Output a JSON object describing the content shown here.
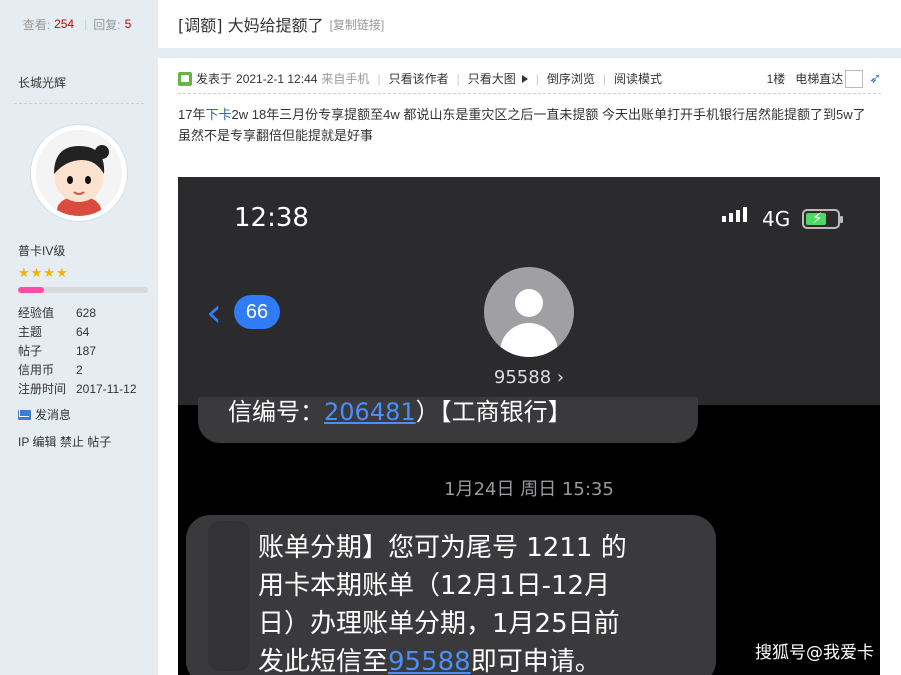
{
  "header": {
    "views_label": "查看:",
    "views": "254",
    "replies_label": "回复:",
    "replies": "5",
    "title": "[调额] 大妈给提额了",
    "copy_link": "[复制链接]"
  },
  "user": {
    "name": "长城光辉",
    "level": "普卡IV级",
    "stars": "★★★★",
    "progress": 0.2,
    "stats": [
      {
        "label": "经验值",
        "value": "628"
      },
      {
        "label": "主题",
        "value": "64"
      },
      {
        "label": "帖子",
        "value": "187"
      },
      {
        "label": "信用币",
        "value": "2"
      },
      {
        "label": "注册时间",
        "value": "2017-11-12"
      }
    ],
    "send_message": "发消息",
    "admin_links": [
      "IP",
      "编辑",
      "禁止",
      "帖子"
    ]
  },
  "post": {
    "posted_prefix": "发表于",
    "date": "2021-2-1 12:44",
    "source": "来自手机",
    "only_author": "只看该作者",
    "only_images": "只看大图",
    "reverse": "倒序浏览",
    "read_mode": "阅读模式",
    "floor": "1楼",
    "elevator": "电梯直达",
    "body_before_link": "17年",
    "body_link": "下卡",
    "body_after_link": "2w 18年三月份专享提额至4w 都说山东是重灾区之后一直未提额 今天出账单打开手机银行居然能提额了到5w了 虽然不是专享翻倍但能提就是好事"
  },
  "phone": {
    "time": "12:38",
    "network": "4G",
    "back_count": "66",
    "contact": "95588 ›",
    "bubble1_prefix": "信编号：",
    "bubble1_link": "206481",
    "bubble1_suffix": "）【工商银行】",
    "sms_date": "1月24日 周日 15:35",
    "bubble2_line1": "账单分期】您可为尾号 1211 的",
    "bubble2_line2": "用卡本期账单（12月1日-12月",
    "bubble2_line3": "日）办理账单分期，1月25日前",
    "bubble2_line4_prefix": "发此短信至",
    "bubble2_line4_link": "95588",
    "bubble2_line4_suffix": "即可申请。",
    "watermark": "搜狐号@我爱卡"
  }
}
